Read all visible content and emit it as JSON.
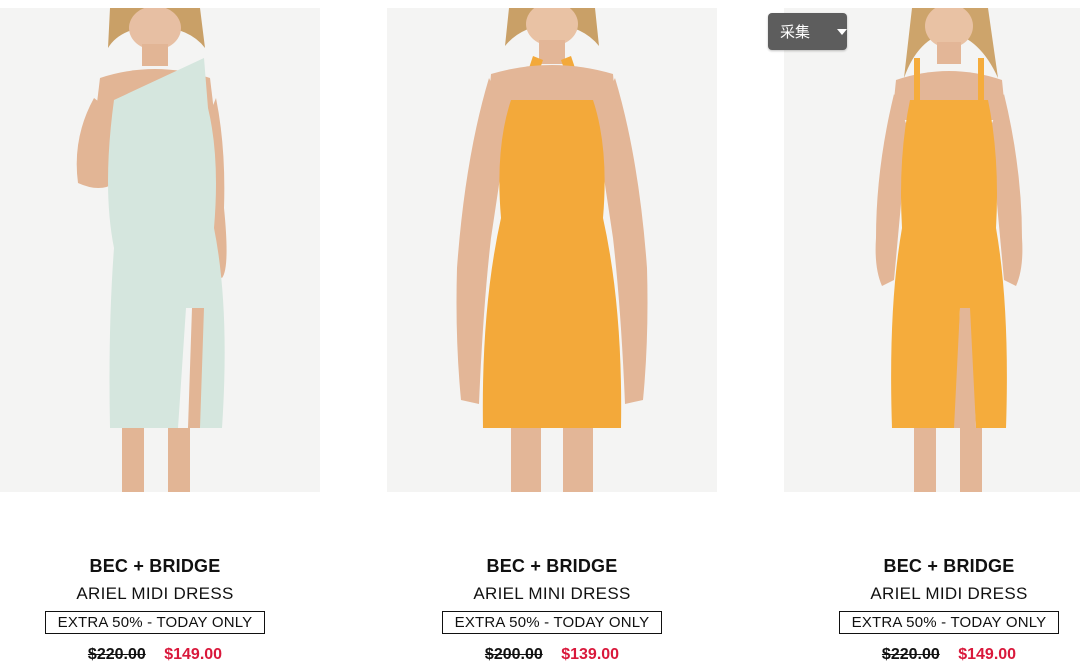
{
  "collect_button": {
    "label": "采集",
    "icon": "caret-down-icon"
  },
  "products": [
    {
      "brand": "BEC + BRIDGE",
      "name": "ARIEL MIDI DRESS",
      "promo": "EXTRA 50% - TODAY ONLY",
      "price_original": "$220.00",
      "price_sale": "$149.00",
      "dress_color": "#d5e6de"
    },
    {
      "brand": "BEC + BRIDGE",
      "name": "ARIEL MINI DRESS",
      "promo": "EXTRA 50% - TODAY ONLY",
      "price_original": "$200.00",
      "price_sale": "$139.00",
      "dress_color": "#f3a93a"
    },
    {
      "brand": "BEC + BRIDGE",
      "name": "ARIEL MIDI DRESS",
      "promo": "EXTRA 50% - TODAY ONLY",
      "price_original": "$220.00",
      "price_sale": "$149.00",
      "dress_color": "#f5ac3c"
    }
  ],
  "colors": {
    "sale_price": "#d9183b",
    "collect_bg": "#5d5d5d"
  }
}
